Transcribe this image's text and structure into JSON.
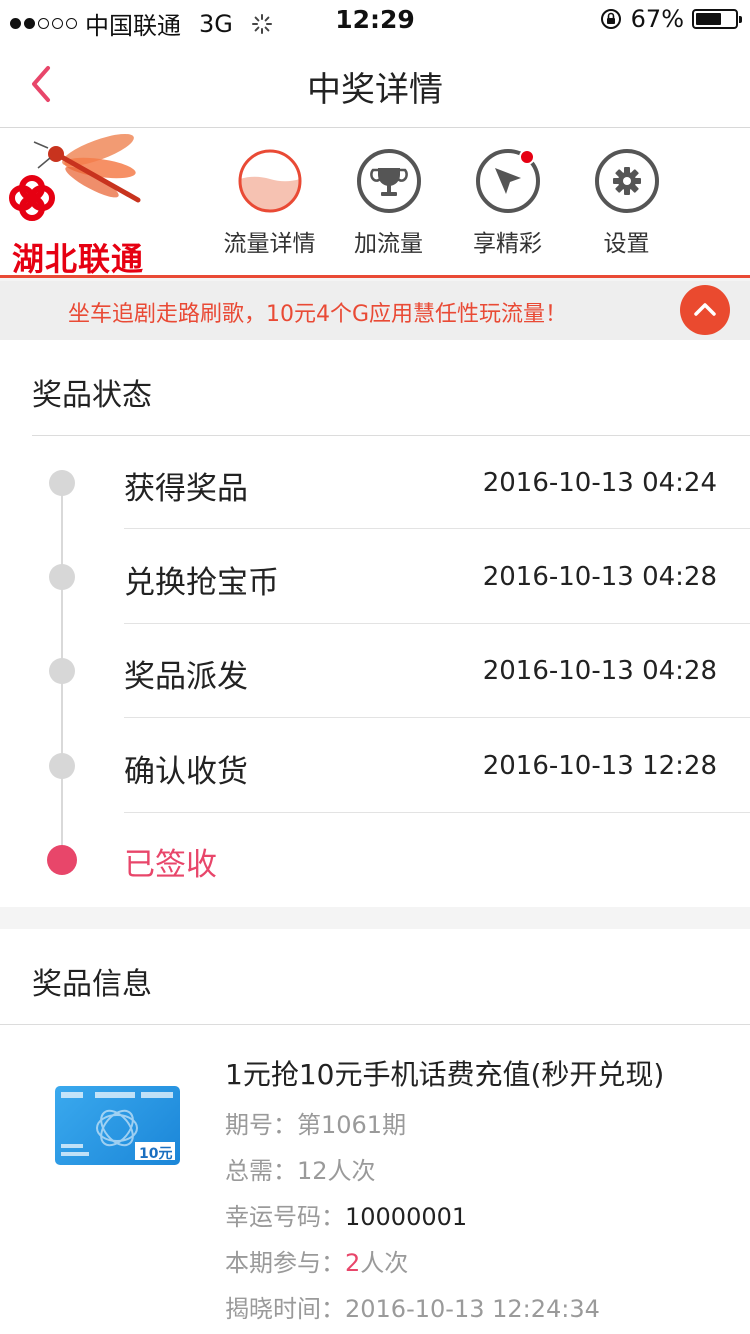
{
  "status_bar": {
    "carrier": "中国联通",
    "network": "3G",
    "time": "12:29",
    "battery_percent": "67%",
    "battery_level": 0.67
  },
  "nav": {
    "title": "中奖详情"
  },
  "unicom": {
    "brand_name": "湖北联通",
    "menu": [
      {
        "label": "流量详情",
        "icon": "data-usage-icon"
      },
      {
        "label": "加流量",
        "icon": "trophy-icon"
      },
      {
        "label": "享精彩",
        "icon": "cursor-icon"
      },
      {
        "label": "设置",
        "icon": "gear-icon"
      }
    ],
    "promo_text": "坐车追剧走路刷歌，10元4个G应用慧任性玩流量！"
  },
  "prize_status": {
    "title": "奖品状态",
    "steps": [
      {
        "label": "获得奖品",
        "time": "2016-10-13 04:24"
      },
      {
        "label": "兑换抢宝币",
        "time": "2016-10-13 04:28"
      },
      {
        "label": "奖品派发",
        "time": "2016-10-13 04:28"
      },
      {
        "label": "确认收货",
        "time": "2016-10-13 12:28"
      },
      {
        "label": "已签收",
        "time": ""
      }
    ]
  },
  "prize_info": {
    "title": "奖品信息",
    "card_value": "10元",
    "product_title": "1元抢10元手机话费充值(秒开兑现)",
    "issue_label": "期号：",
    "issue_value": "第1061期",
    "total_label": "总需：",
    "total_value": "12人次",
    "lucky_label": "幸运号码：",
    "lucky_value": "10000001",
    "participate_label": "本期参与：",
    "participate_count": "2",
    "participate_unit": "人次",
    "reveal_label": "揭晓时间：",
    "reveal_value": "2016-10-13 12:24:34"
  },
  "colors": {
    "accent": "#e8466a",
    "unicom_red": "#e94a35"
  }
}
